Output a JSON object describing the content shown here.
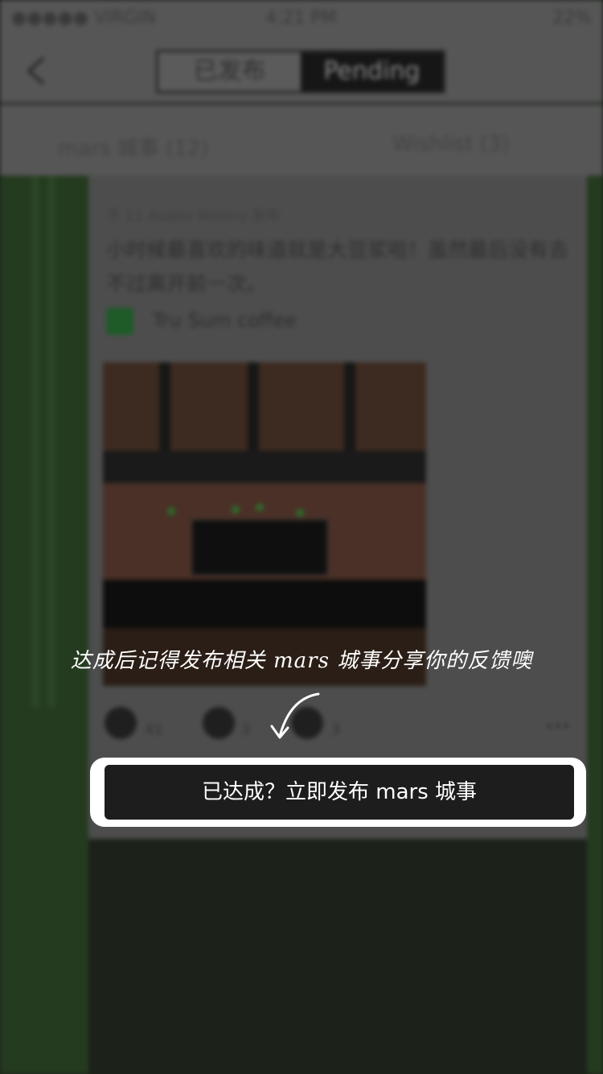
{
  "status_bar": {
    "carrier": "●●●●● VIRGIN",
    "time": "4:21 PM",
    "battery": "22%"
  },
  "nav": {
    "back_icon": "chevron-left-icon",
    "segments": [
      {
        "label": "已发布"
      },
      {
        "label": "Pending"
      }
    ]
  },
  "subbar": {
    "left": "mars 城事 (12)",
    "right": "Wishlist (3)"
  },
  "post": {
    "meta": "于 11 Asano Minoru 发布",
    "text": "小时候最喜欢的味道就是大豆浆啦！虽然最后没有去不过离开前一次。",
    "shop": "Tru Sum coffee",
    "actions": {
      "likes": "41",
      "comments": "3",
      "shares": "3",
      "more": "•••"
    }
  },
  "overlay": {
    "hint": "达成后记得发布相关 mars 城事分享你的反馈噢",
    "arrow_icon": "curved-arrow-down-icon",
    "cta": "已达成？立即发布 mars 城事"
  },
  "colors": {
    "overlay_dim": "#1c221a",
    "cta_bg": "#1d1d1d",
    "cta_border": "#ffffff"
  }
}
